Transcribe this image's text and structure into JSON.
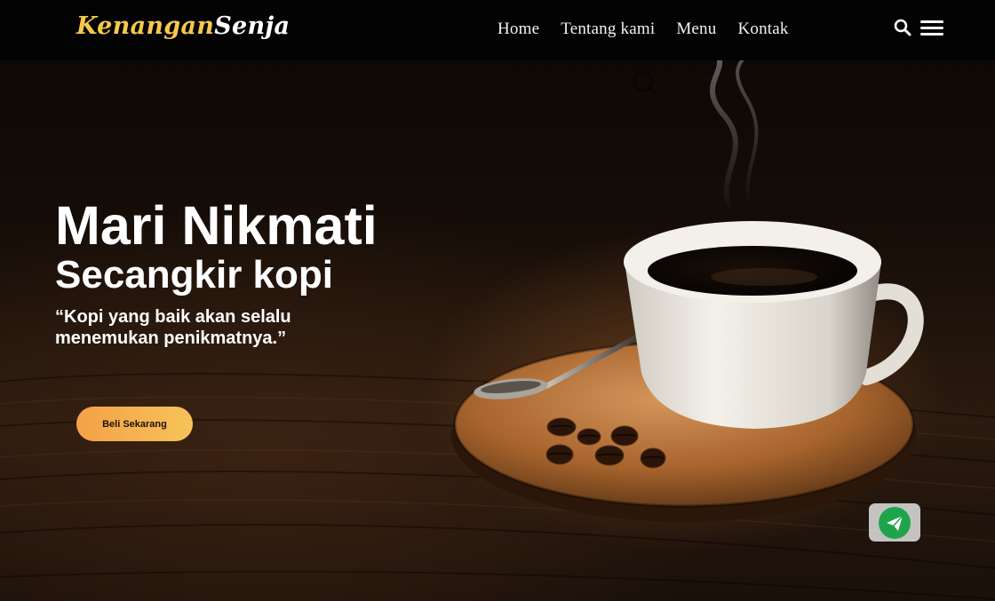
{
  "header": {
    "brand_primary": "Kenangan",
    "brand_secondary": "Senja",
    "nav": [
      "Home",
      "Tentang kami",
      "Menu",
      "Kontak"
    ],
    "icons": [
      "search-icon",
      "hamburger-menu-icon"
    ]
  },
  "hero": {
    "title": "Mari Nikmati",
    "subtitle": "Secangkir kopi",
    "quote": "“Kopi yang baik akan selalu menemukan penikmatnya.”",
    "cta_label": "Beli Sekarang",
    "background_subject": "coffee cup on wooden saucer with spoon and coffee beans"
  },
  "floating": {
    "icon": "telegram-icon"
  },
  "colors": {
    "brand_accent": "#f6c84c",
    "cta_start": "#f4a247",
    "cta_end": "#f7c25a",
    "navbar_bg": "#030303",
    "telegram_green": "#20a44b"
  }
}
